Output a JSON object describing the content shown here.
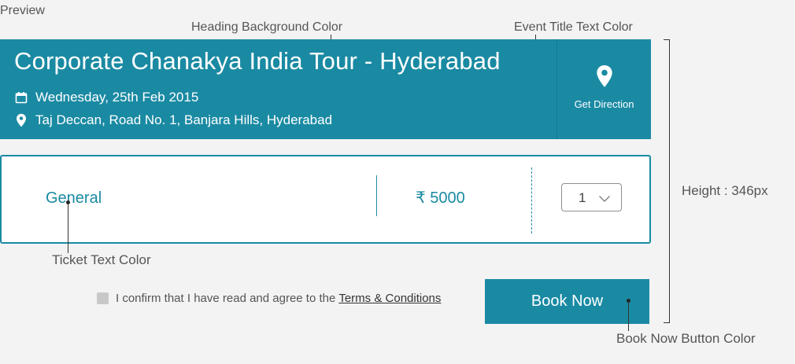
{
  "annotations": {
    "preview": "Preview",
    "heading_bg": "Heading Background Color",
    "event_title_color": "Event Title Text Color",
    "height": "Height : 346px",
    "ticket_text_color": "Ticket Text Color",
    "book_now_color": "Book Now Button Color"
  },
  "event": {
    "title": "Corporate Chanakya India Tour - Hyderabad",
    "date": "Wednesday, 25th Feb 2015",
    "venue": "Taj Deccan, Road No. 1, Banjara Hills, Hyderabad",
    "direction_label": "Get Direction",
    "calendar_icon": "calendar-icon",
    "location_icon": "location-pin-icon"
  },
  "ticket": {
    "name": "General",
    "price": "₹ 5000",
    "quantity": "1"
  },
  "footer": {
    "confirm_text": "I confirm that I have read and agree to the",
    "terms_link": "Terms & Conditions",
    "book_button": "Book Now"
  },
  "colors": {
    "accent": "#1a8aa3",
    "page_bg": "#f3f3f4",
    "checkbox": "#c8c8c8"
  }
}
